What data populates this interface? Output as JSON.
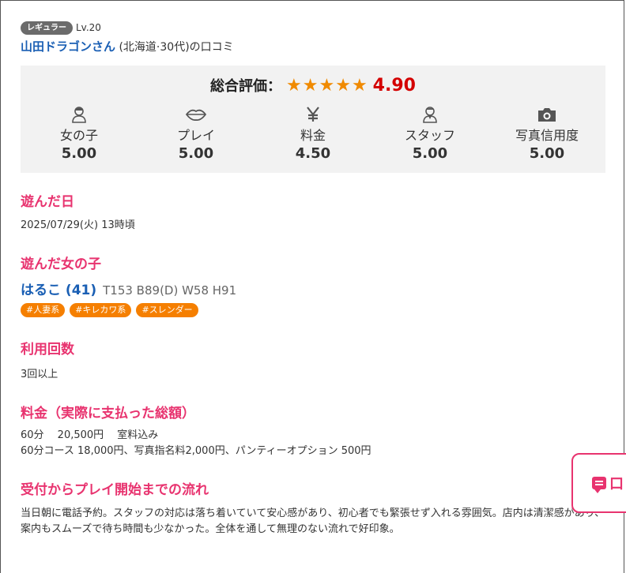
{
  "reviewer": {
    "rank_badge": "レギュラー",
    "level": "Lv.20",
    "name": "山田ドラゴンさん",
    "meta": " (北海道·30代)の口コミ"
  },
  "rating": {
    "overall_label": "総合評価：",
    "stars": "★★★★★",
    "overall_score": "4.90",
    "categories": [
      {
        "label": "女の子",
        "value": "5.00",
        "icon": "girl-icon"
      },
      {
        "label": "プレイ",
        "value": "5.00",
        "icon": "lips-icon"
      },
      {
        "label": "料金",
        "value": "4.50",
        "icon": "yen-icon"
      },
      {
        "label": "スタッフ",
        "value": "5.00",
        "icon": "staff-icon"
      },
      {
        "label": "写真信用度",
        "value": "5.00",
        "icon": "camera-icon"
      }
    ]
  },
  "visit_date": {
    "title": "遊んだ日",
    "text": "2025/07/29(火) 13時頃"
  },
  "girl": {
    "title": "遊んだ女の子",
    "name": "はるこ (41)",
    "stats": "T153 B89(D) W58 H91",
    "tags": [
      "#人妻系",
      "#キレカワ系",
      "#スレンダー"
    ]
  },
  "usage_count": {
    "title": "利用回数",
    "text": "3回以上"
  },
  "price": {
    "title": "料金（実際に支払った総額）",
    "line1": "60分　 20,500円　 室料込み",
    "line2": "60分コース 18,000円、写真指名料2,000円、パンティーオプション 500円"
  },
  "flow": {
    "title": "受付からプレイ開始までの流れ",
    "text": "当日朝に電話予約。スタッフの対応は落ち着いていて安心感があり、初心者でも緊張せず入れる雰囲気。店内は清潔感があり、案内もスムーズで待ち時間も少なかった。全体を通して無理のない流れで好印象。"
  },
  "floating_button": {
    "label": "口",
    "icon": "chat-icon"
  },
  "colors": {
    "accent_pink": "#e8336f",
    "link_blue": "#1a5fb4",
    "star_orange": "#f08a00",
    "score_red": "#d40000",
    "tag_orange": "#f57f00"
  }
}
